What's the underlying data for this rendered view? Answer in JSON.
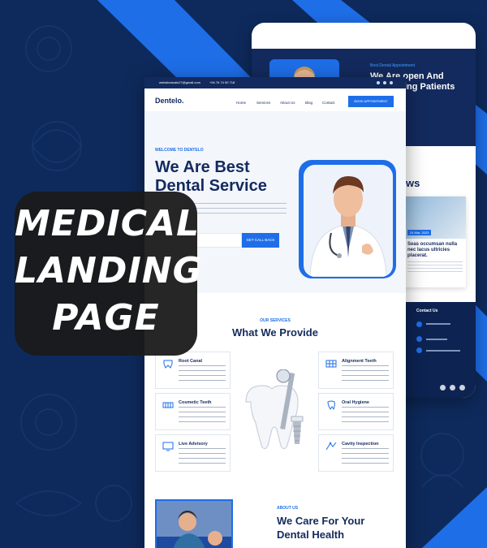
{
  "banner": {
    "line1": "MEDICAL",
    "line2": "LANDING",
    "line3": "PAGE"
  },
  "back_page": {
    "kicker": "Best Dental Appointment",
    "title": "We Are open And Welcoming Patients",
    "section_heading": "ws",
    "blog": {
      "tag": "24 Mar, 2023",
      "title": "Seas occumsan nulla nec lacus ultricies placerat."
    },
    "footer": {
      "contact_heading": "Contact Us"
    }
  },
  "topbar": {
    "email": "websitestudio27@gmail.com",
    "phone": "+94 76 74 90 718"
  },
  "nav": {
    "logo": "Dentelo.",
    "links": [
      "Home",
      "Services",
      "About Us",
      "Blog",
      "Contact"
    ],
    "cta": "BOOK APPOINTMENT"
  },
  "hero": {
    "kicker": "WELCOME TO DENTELO",
    "title": "We Are Best Dental Service",
    "button": "GET CALL BACK"
  },
  "services": {
    "kicker": "OUR SERVICES",
    "title": "What We Provide",
    "items": [
      {
        "name": "Root Canal"
      },
      {
        "name": "Cosmetic Teeth"
      },
      {
        "name": "Live Advisory"
      },
      {
        "name": "Alignment Teeth"
      },
      {
        "name": "Oral Hygiene"
      },
      {
        "name": "Cavity Inspection"
      }
    ]
  },
  "about": {
    "kicker": "ABOUT US",
    "title": "We Care For Your Dental Health"
  },
  "colors": {
    "navy": "#132a5e",
    "accent_blue": "#1e6ee8",
    "background": "#0e2a5c"
  }
}
